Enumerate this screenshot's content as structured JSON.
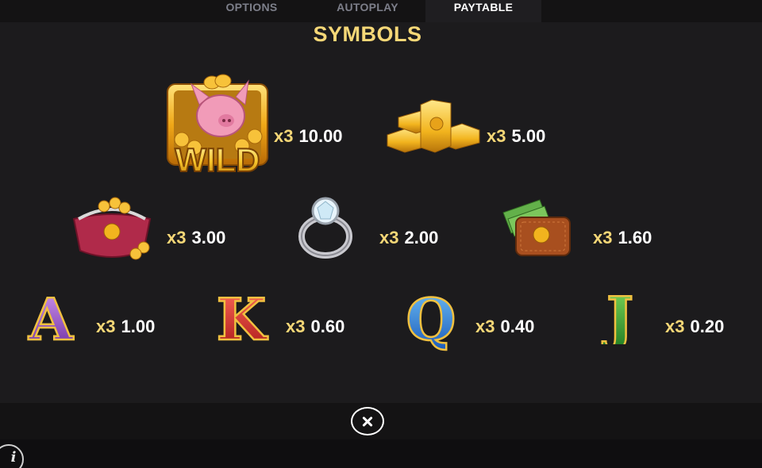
{
  "tabs": [
    {
      "label": "OPTIONS",
      "active": false
    },
    {
      "label": "AUTOPLAY",
      "active": false
    },
    {
      "label": "PAYTABLE",
      "active": true
    }
  ],
  "title": "SYMBOLS",
  "symbols": [
    {
      "name": "wild-pig",
      "label": "WILD",
      "multiplier": "x3",
      "payout": "10.00"
    },
    {
      "name": "gold-bars",
      "multiplier": "x3",
      "payout": "5.00"
    },
    {
      "name": "coin-purse",
      "multiplier": "x3",
      "payout": "3.00"
    },
    {
      "name": "diamond-ring",
      "multiplier": "x3",
      "payout": "2.00"
    },
    {
      "name": "wallet",
      "multiplier": "x3",
      "payout": "1.60"
    },
    {
      "name": "letter-a",
      "label": "A",
      "multiplier": "x3",
      "payout": "1.00"
    },
    {
      "name": "letter-k",
      "label": "K",
      "multiplier": "x3",
      "payout": "0.60"
    },
    {
      "name": "letter-q",
      "label": "Q",
      "multiplier": "x3",
      "payout": "0.40"
    },
    {
      "name": "letter-j",
      "label": "J",
      "multiplier": "x3",
      "payout": "0.20"
    }
  ],
  "footer": {
    "close_icon": "close-icon",
    "info_label": "i"
  },
  "colors": {
    "accent": "#f5d777",
    "background": "#1c1b1d",
    "tab_bar": "#141314"
  }
}
